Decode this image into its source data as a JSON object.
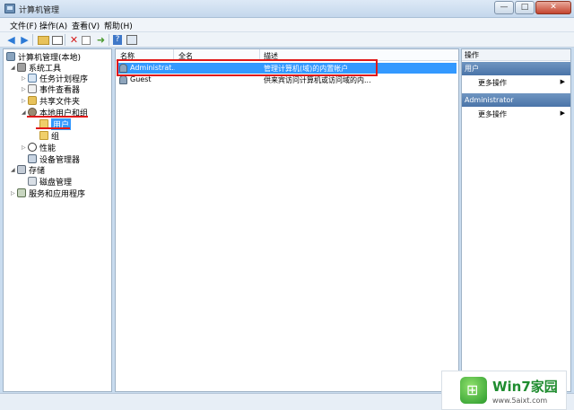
{
  "window": {
    "title": "计算机管理",
    "controls": {
      "minimize": "—",
      "maximize": "□",
      "close": "✕"
    }
  },
  "menu": [
    "文件(F)",
    "操作(A)",
    "查看(V)",
    "帮助(H)"
  ],
  "tree": {
    "root": "计算机管理(本地)",
    "system_tools": "系统工具",
    "task_scheduler": "任务计划程序",
    "event_viewer": "事件查看器",
    "shared_folders": "共享文件夹",
    "local_users_groups": "本地用户和组",
    "users": "用户",
    "groups": "组",
    "performance": "性能",
    "device_manager": "设备管理器",
    "storage": "存储",
    "disk_management": "磁盘管理",
    "services_apps": "服务和应用程序"
  },
  "list": {
    "columns": [
      "名称",
      "全名",
      "描述"
    ],
    "rows": [
      {
        "name": "Administrat...",
        "fullname": "",
        "description": "管理计算机(域)的内置帐户"
      },
      {
        "name": "Guest",
        "fullname": "",
        "description": "供来宾访问计算机或访问域的内..."
      }
    ]
  },
  "actions": {
    "title": "操作",
    "section1": "用户",
    "section1_item": "更多操作",
    "section2": "Administrator",
    "section2_item": "更多操作"
  },
  "watermark": {
    "brand": "Win7家园",
    "url": "www.5aixt.com"
  },
  "colors": {
    "selection": "#3399ff",
    "annotation": "#e01818"
  }
}
